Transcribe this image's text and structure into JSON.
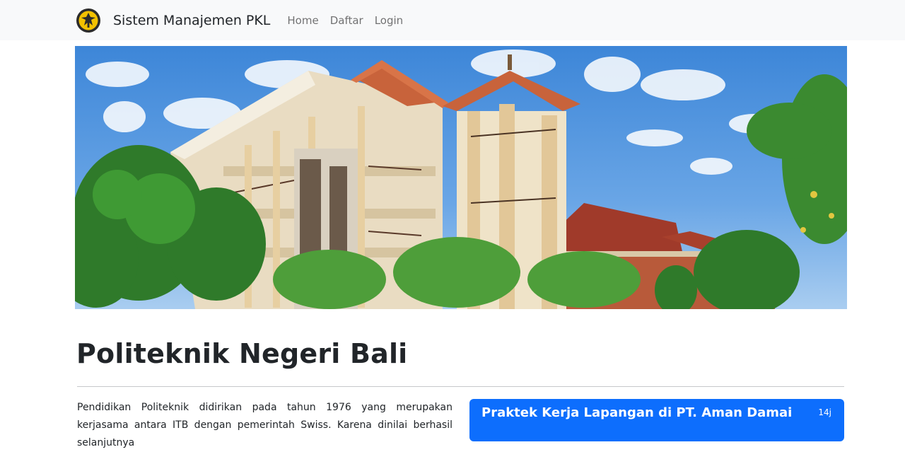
{
  "navbar": {
    "brand": "Sistem Manajemen PKL",
    "links": [
      {
        "label": "Home"
      },
      {
        "label": "Daftar"
      },
      {
        "label": "Login"
      }
    ]
  },
  "hero": {
    "icon": "campus-building-photo"
  },
  "main": {
    "title": "Politeknik Negeri Bali",
    "intro": "Pendidikan Politeknik didirikan pada tahun 1976 yang merupakan kerjasama antara ITB dengan pemerintah Swiss. Karena dinilai berhasil selanjutnya"
  },
  "news_card": {
    "title": "Praktek Kerja Lapangan di PT. Aman Damai",
    "time": "14j"
  },
  "colors": {
    "navbar_bg": "#f8f9fa",
    "card_bg": "#0d6efd"
  }
}
